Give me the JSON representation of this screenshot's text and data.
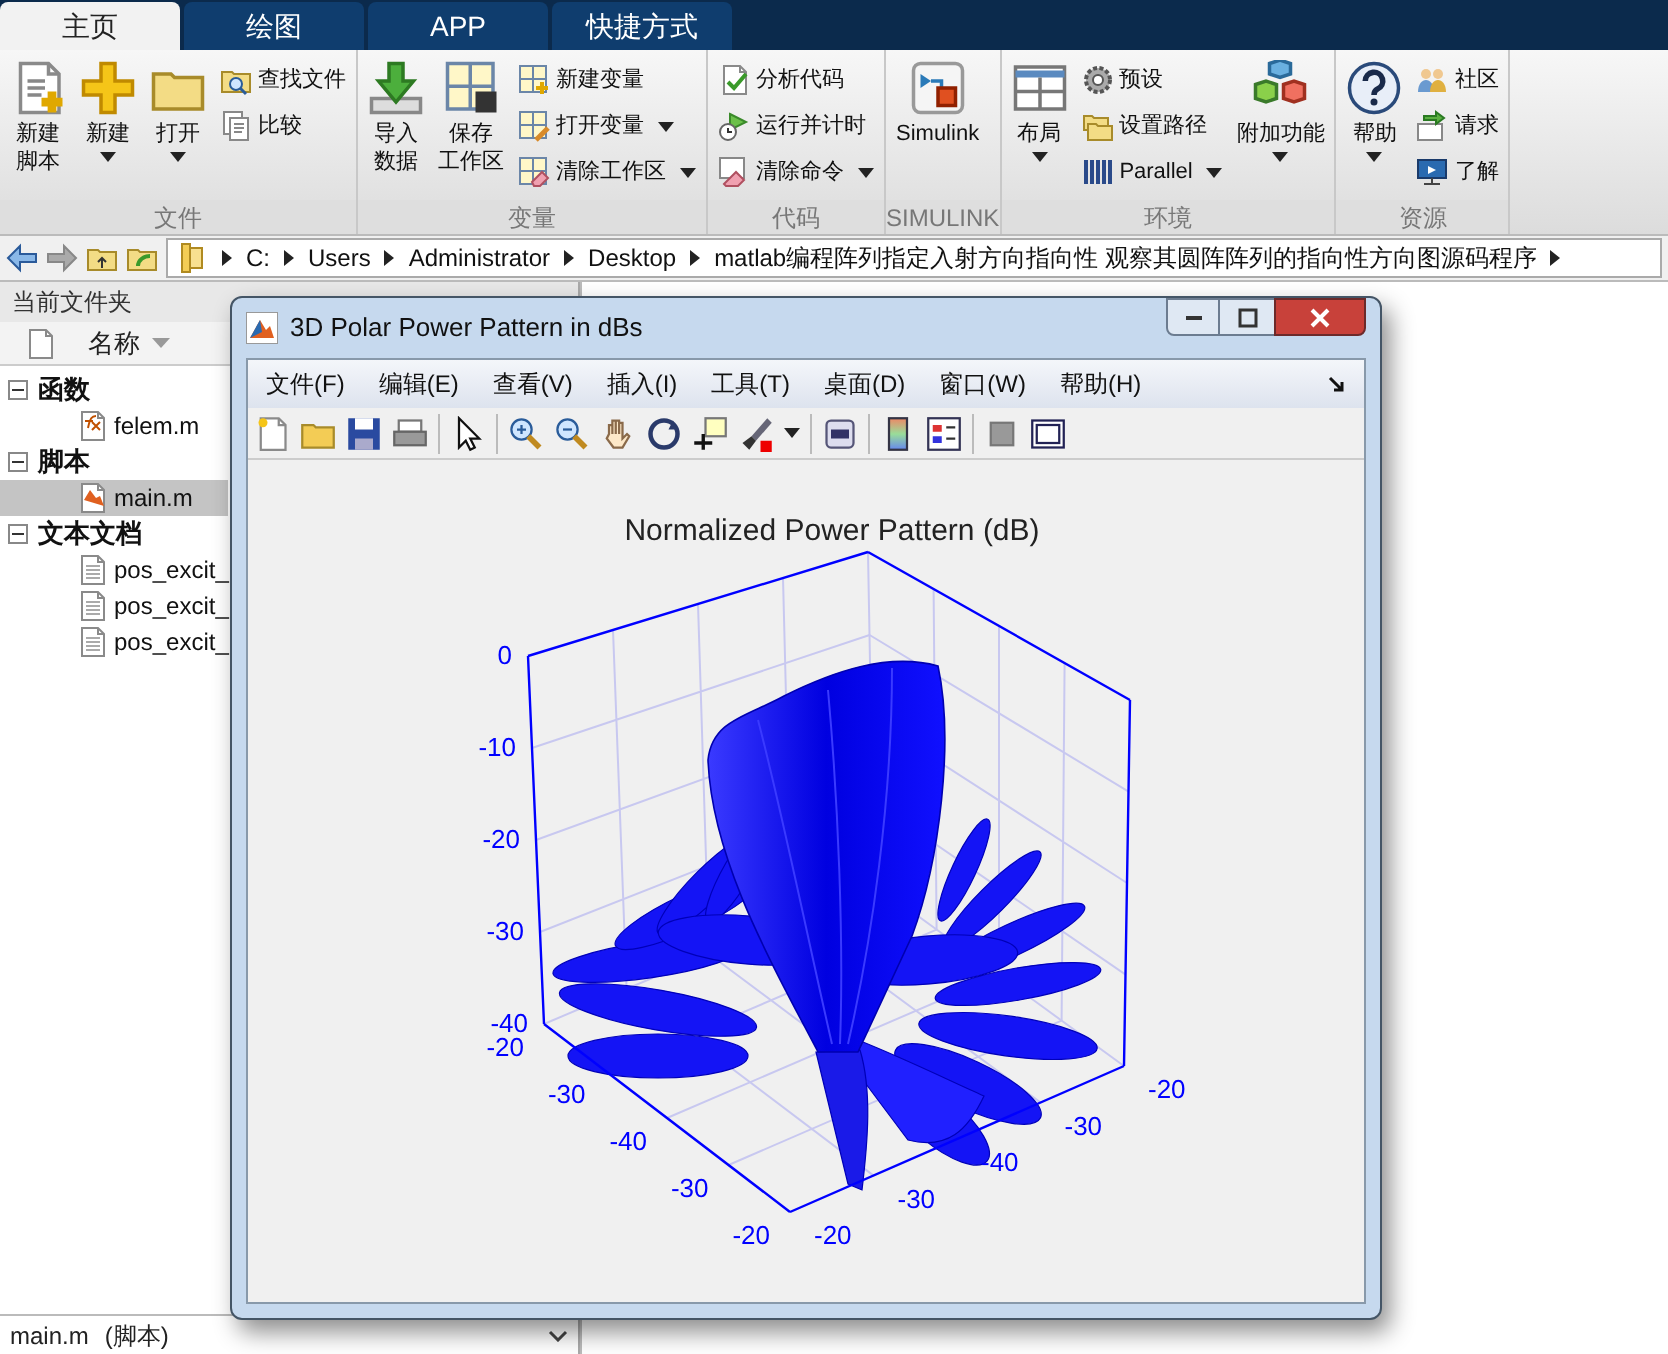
{
  "tabs": [
    {
      "label": "主页",
      "selected": true
    },
    {
      "label": "绘图",
      "selected": false
    },
    {
      "label": "APP",
      "selected": false
    },
    {
      "label": "快捷方式",
      "selected": false
    }
  ],
  "ribbon": {
    "groups": [
      {
        "label": "文件",
        "items": [
          {
            "kind": "large",
            "label": [
              "新建",
              "脚本"
            ],
            "dropdown": false
          },
          {
            "kind": "large",
            "label": [
              "新建"
            ],
            "dropdown": true
          },
          {
            "kind": "large",
            "label": [
              "打开"
            ],
            "dropdown": true
          },
          {
            "kind": "small",
            "label": [
              "查找文件"
            ],
            "dropdown": false
          },
          {
            "kind": "small",
            "label": [
              "比较"
            ],
            "dropdown": false
          }
        ]
      },
      {
        "label": "变量",
        "items": [
          {
            "kind": "large",
            "label": [
              "导入",
              "数据"
            ],
            "dropdown": false
          },
          {
            "kind": "large",
            "label": [
              "保存",
              "工作区"
            ],
            "dropdown": false
          },
          {
            "kind": "small",
            "label": [
              "新建变量"
            ],
            "dropdown": false
          },
          {
            "kind": "small",
            "label": [
              "打开变量"
            ],
            "dropdown": true
          },
          {
            "kind": "small",
            "label": [
              "清除工作区"
            ],
            "dropdown": true
          }
        ]
      },
      {
        "label": "代码",
        "items": [
          {
            "kind": "small",
            "label": [
              "分析代码"
            ],
            "dropdown": false
          },
          {
            "kind": "small",
            "label": [
              "运行并计时"
            ],
            "dropdown": false
          },
          {
            "kind": "small",
            "label": [
              "清除命令"
            ],
            "dropdown": true
          }
        ]
      },
      {
        "label": "SIMULINK",
        "items": [
          {
            "kind": "large",
            "label": [
              "Simulink"
            ],
            "dropdown": false
          }
        ]
      },
      {
        "label": "环境",
        "items": [
          {
            "kind": "large",
            "label": [
              "布局"
            ],
            "dropdown": true
          },
          {
            "kind": "small",
            "label": [
              "预设"
            ],
            "dropdown": false
          },
          {
            "kind": "small",
            "label": [
              "设置路径"
            ],
            "dropdown": false
          },
          {
            "kind": "small",
            "label": [
              "Parallel"
            ],
            "dropdown": true
          },
          {
            "kind": "large",
            "label": [
              "附加功能"
            ],
            "dropdown": true
          }
        ]
      },
      {
        "label": "资源",
        "items": [
          {
            "kind": "large",
            "label": [
              "帮助"
            ],
            "dropdown": true
          },
          {
            "kind": "small",
            "label": [
              "社区"
            ],
            "dropdown": false
          },
          {
            "kind": "small",
            "label": [
              "请求"
            ],
            "dropdown": false
          },
          {
            "kind": "small",
            "label": [
              "了解"
            ],
            "dropdown": false
          }
        ]
      }
    ]
  },
  "address_bar": {
    "path": [
      "C:",
      "Users",
      "Administrator",
      "Desktop",
      "matlab编程阵列指定入射方向指向性 观察其圆阵阵列的指向性方向图源码程序"
    ]
  },
  "file_browser": {
    "title": "当前文件夹",
    "column": "名称",
    "groups": [
      {
        "label": "函数",
        "expanded": true,
        "children": [
          {
            "label": "felem.m",
            "kind": "function",
            "selected": false
          }
        ]
      },
      {
        "label": "脚本",
        "expanded": true,
        "children": [
          {
            "label": "main.m",
            "kind": "script",
            "selected": true
          }
        ]
      },
      {
        "label": "文本文档",
        "expanded": true,
        "children": [
          {
            "label": "pos_excit_",
            "kind": "text",
            "selected": false
          },
          {
            "label": "pos_excit_",
            "kind": "text",
            "selected": false
          },
          {
            "label": "pos_excit_",
            "kind": "text",
            "selected": false
          }
        ]
      }
    ],
    "footer": {
      "file": "main.m",
      "type": "(脚本)"
    }
  },
  "figure": {
    "title": "3D Polar Power Pattern in dBs",
    "menu": [
      "文件(F)",
      "编辑(E)",
      "查看(V)",
      "插入(I)",
      "工具(T)",
      "桌面(D)",
      "窗口(W)",
      "帮助(H)"
    ],
    "plot": {
      "title": "Normalized Power Pattern (dB)",
      "z_ticks": [
        "0",
        "-10",
        "-20",
        "-30",
        "-40"
      ],
      "x_ticks": [
        "-20",
        "-30",
        "-40",
        "-30",
        "-20"
      ],
      "y_ticks": [
        "-20",
        "-30",
        "-40",
        "-30",
        "-20"
      ]
    }
  }
}
